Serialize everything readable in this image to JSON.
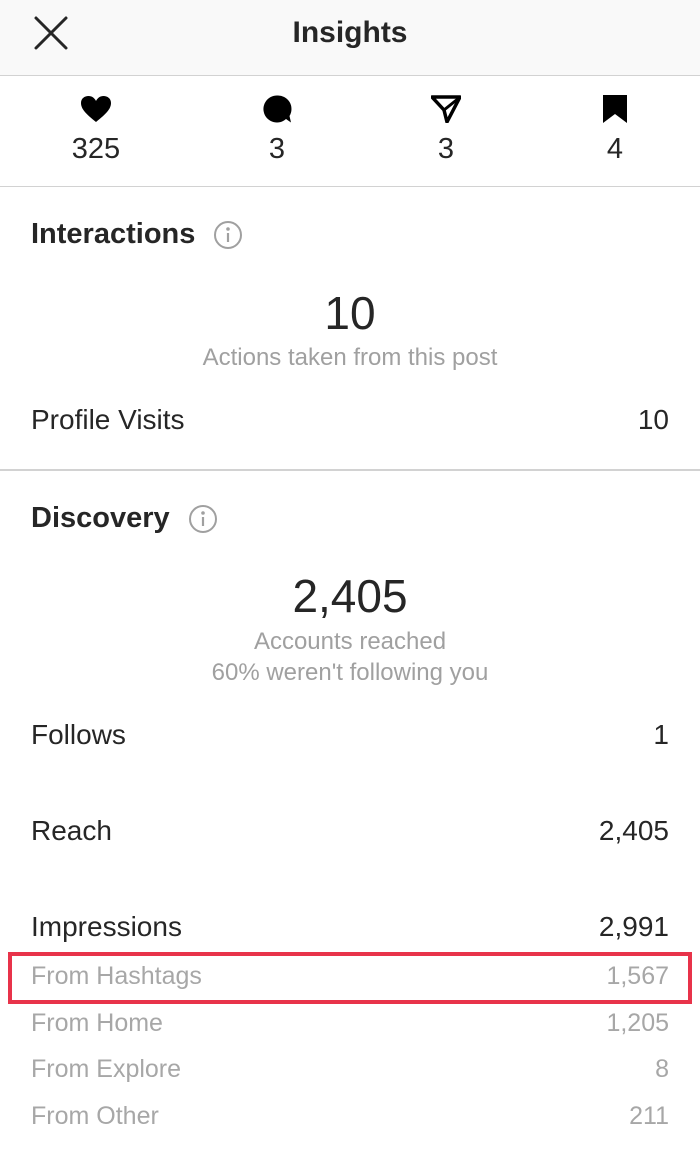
{
  "header": {
    "title": "Insights",
    "close_icon": "close-icon"
  },
  "stats": [
    {
      "icon": "heart-icon",
      "value": "325"
    },
    {
      "icon": "comment-icon",
      "value": "3"
    },
    {
      "icon": "share-icon",
      "value": "3"
    },
    {
      "icon": "bookmark-icon",
      "value": "4"
    }
  ],
  "interactions": {
    "title": "Interactions",
    "info_icon": "info-icon",
    "total": "10",
    "caption": "Actions taken from this post",
    "rows": [
      {
        "label": "Profile Visits",
        "value": "10"
      }
    ]
  },
  "discovery": {
    "title": "Discovery",
    "info_icon": "info-icon",
    "total": "2,405",
    "caption_1": "Accounts reached",
    "caption_2": "60% weren't following you",
    "rows": [
      {
        "label": "Follows",
        "value": "1"
      },
      {
        "label": "Reach",
        "value": "2,405"
      },
      {
        "label": "Impressions",
        "value": "2,991"
      }
    ],
    "impression_sources": [
      {
        "label": "From Hashtags",
        "value": "1,567"
      },
      {
        "label": "From Home",
        "value": "1,205"
      },
      {
        "label": "From Explore",
        "value": "8"
      },
      {
        "label": "From Other",
        "value": "211"
      }
    ]
  },
  "colors": {
    "highlight": "#e8334a",
    "text": "#262626",
    "muted": "#a0a0a0"
  }
}
